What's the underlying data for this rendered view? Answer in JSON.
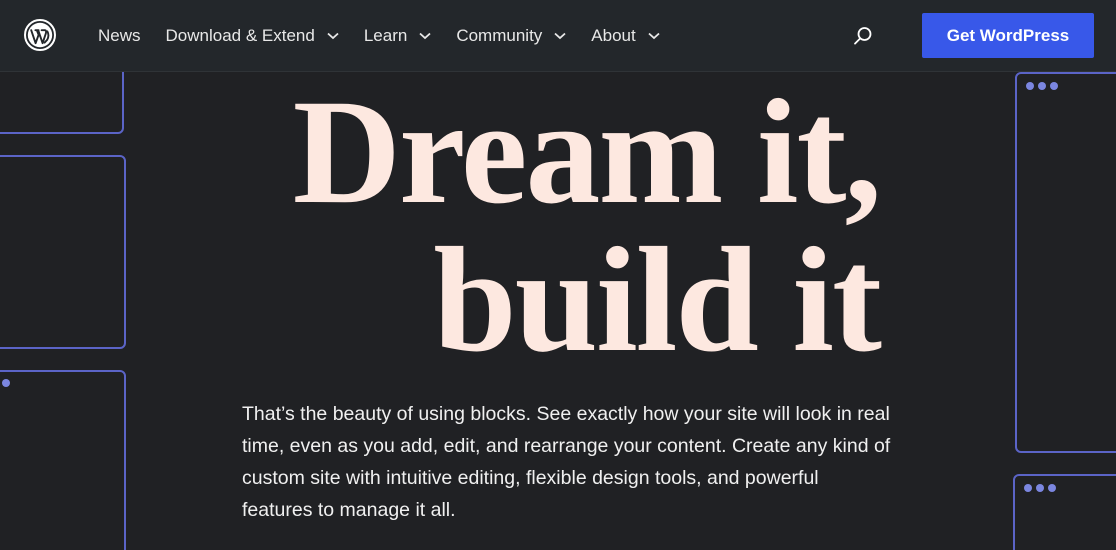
{
  "header": {
    "logo_icon": "wordpress-logo-icon",
    "nav": [
      {
        "label": "News",
        "has_dropdown": false
      },
      {
        "label": "Download & Extend",
        "has_dropdown": true
      },
      {
        "label": "Learn",
        "has_dropdown": true
      },
      {
        "label": "Community",
        "has_dropdown": true
      },
      {
        "label": "About",
        "has_dropdown": true
      }
    ],
    "search_icon": "search-icon",
    "cta_label": "Get WordPress"
  },
  "hero": {
    "headline_line1": "Dream it,",
    "headline_line2": "build it",
    "body": "That’s the beauty of using blocks. See exactly how your site will look in real time, even as you add, edit, and rearrange your content. Create any kind of custom site with intuitive editing, flexible design tools, and powerful features to manage it all."
  },
  "colors": {
    "background": "#202124",
    "header_bg": "#23272b",
    "accent": "#3858e9",
    "headline": "#fde8e0",
    "frame_stroke": "#5b64c7"
  }
}
